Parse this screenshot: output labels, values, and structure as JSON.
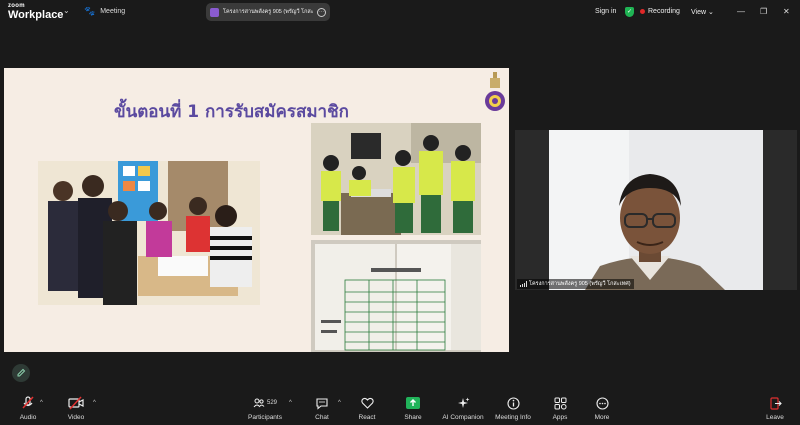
{
  "app": {
    "brand_small": "zoom",
    "brand_big": "Workplace",
    "meeting_label": "Meeting",
    "meeting_pill_text": "โครงการสานพลังครู 905 (พรัญวี โกสะ...",
    "sign_in": "Sign in",
    "recording": "Recording",
    "view": "View"
  },
  "slide": {
    "title": "ขั้นตอนที่ 1 การรับสมัครสมาชิก"
  },
  "speaker": {
    "name": "โครงการสานพลังครู 905 (พรัญวี โกสะเทศ)"
  },
  "toolbar": {
    "audio": "Audio",
    "video": "Video",
    "participants": "Participants",
    "participants_count": "529",
    "chat": "Chat",
    "react": "React",
    "share": "Share",
    "ai_companion": "AI Companion",
    "meeting_info": "Meeting Info",
    "apps": "Apps",
    "more": "More",
    "leave": "Leave"
  },
  "colors": {
    "slide_title": "#5b4aa0",
    "share_green": "#21b35a",
    "mute_red": "#e03030",
    "recording_red": "#e02828"
  },
  "icons": [
    "chevron-down-icon",
    "paw-icon",
    "shield-check-icon",
    "minimize-icon",
    "restore-icon",
    "close-icon",
    "mic-muted-icon",
    "video-off-icon",
    "participants-icon",
    "chat-icon",
    "heart-icon",
    "share-arrow-icon",
    "sparkle-icon",
    "info-icon",
    "apps-icon",
    "more-icon",
    "leave-icon",
    "pen-icon"
  ]
}
